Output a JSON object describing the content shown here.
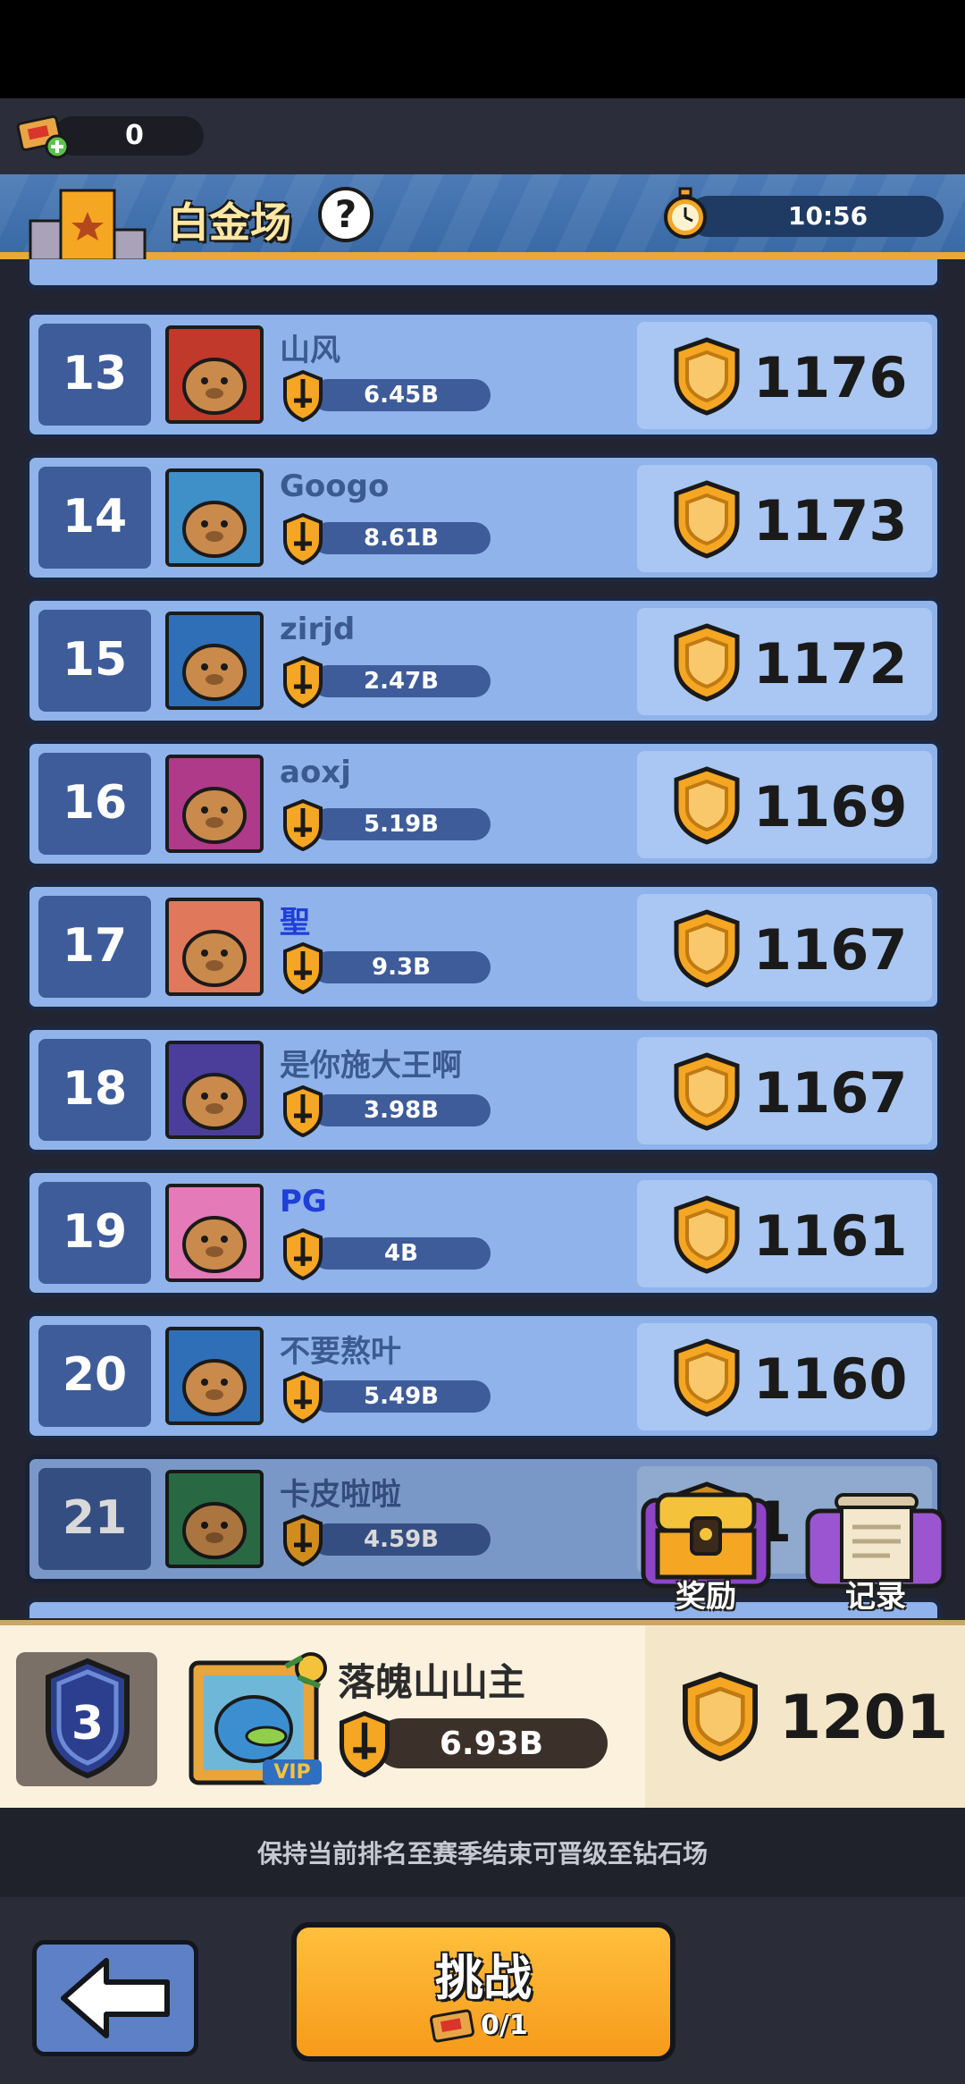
{
  "ticket": {
    "count": "0"
  },
  "header": {
    "title": "白金场",
    "help": "?",
    "timer": "10:56"
  },
  "players": [
    {
      "rank": "13",
      "name": "山风",
      "power": "6.45B",
      "score": "1176",
      "name_color": "#3c5a92",
      "avatar_bg": "#c0392b"
    },
    {
      "rank": "14",
      "name": "Googo",
      "power": "8.61B",
      "score": "1173",
      "name_color": "#3c5a92",
      "avatar_bg": "#3f8fc9"
    },
    {
      "rank": "15",
      "name": "zirjd",
      "power": "2.47B",
      "score": "1172",
      "name_color": "#3c5a92",
      "avatar_bg": "#2e6fb8"
    },
    {
      "rank": "16",
      "name": "aoxj",
      "power": "5.19B",
      "score": "1169",
      "name_color": "#3c5a92",
      "avatar_bg": "#b03a8a"
    },
    {
      "rank": "17",
      "name": "聖",
      "power": "9.3B",
      "score": "1167",
      "name_color": "#1f3fd6",
      "avatar_bg": "#e0785c"
    },
    {
      "rank": "18",
      "name": "是你施大王啊",
      "power": "3.98B",
      "score": "1167",
      "name_color": "#3c5a92",
      "avatar_bg": "#4a3e9a"
    },
    {
      "rank": "19",
      "name": "PG",
      "power": "4B",
      "score": "1161",
      "name_color": "#1f3fd6",
      "avatar_bg": "#e47ab8"
    },
    {
      "rank": "20",
      "name": "不要熬叶",
      "power": "5.49B",
      "score": "1160",
      "name_color": "#3c5a92",
      "avatar_bg": "#2e6fb8"
    },
    {
      "rank": "21",
      "name": "卡皮啦啦",
      "power": "4.59B",
      "score": "1",
      "name_color": "#3c5a92",
      "avatar_bg": "#2f7a4f"
    }
  ],
  "float_buttons": {
    "reward": "奖励",
    "record": "记录"
  },
  "me": {
    "rank": "3",
    "name": "落魄山山主",
    "power": "6.93B",
    "score": "1201",
    "vip": "VIP"
  },
  "hint": "保持当前排名至赛季结束可晋级至钻石场",
  "bottom": {
    "challenge": "挑战",
    "cost": "0/1"
  },
  "colors": {
    "row": "#8fb3ea",
    "rank_box": "#3e5c99",
    "accent": "#f5a623"
  }
}
